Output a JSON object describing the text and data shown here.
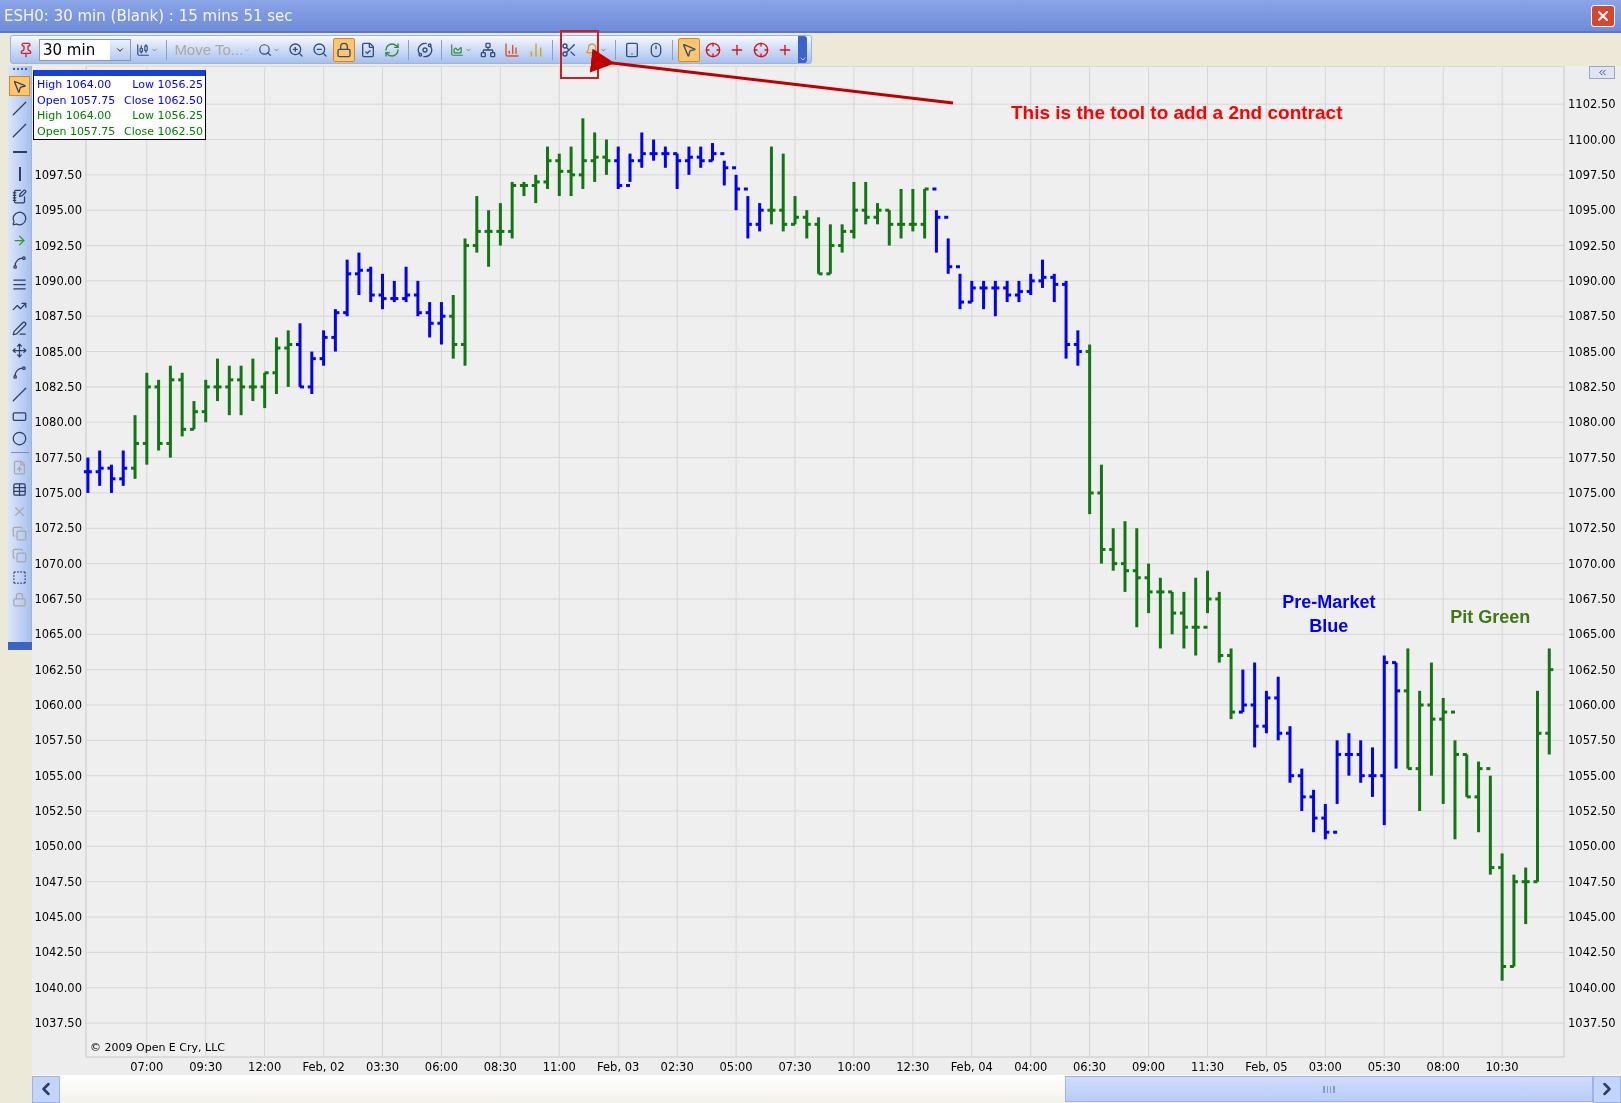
{
  "window": {
    "title": "ESH0: 30 min (Blank) : 15 mins 51 sec"
  },
  "toolbar": {
    "interval": "30 min",
    "move_to": {
      "label": "Move To...",
      "disabled": true
    },
    "buttons": [
      {
        "selected": false
      },
      {
        "selected": false
      },
      {
        "selected": false
      },
      {
        "selected": false
      },
      {
        "selected": false
      },
      {
        "selected": true
      },
      {
        "selected": false
      },
      {
        "selected": false
      },
      {
        "selected": false
      },
      {
        "selected": false
      },
      {
        "selected": false
      },
      {
        "selected": false
      },
      {
        "selected": false
      },
      {
        "selected": false
      },
      {
        "selected": false
      },
      {
        "selected": false
      },
      {
        "selected": false
      },
      {
        "selected": true
      },
      {
        "selected": false
      },
      {
        "selected": false
      },
      {
        "selected": false
      },
      {
        "selected": false
      }
    ]
  },
  "drawing_tools": [
    {
      "selected": true,
      "disabled": false
    },
    {
      "selected": false,
      "disabled": false
    },
    {
      "selected": false,
      "disabled": false
    },
    {
      "selected": false,
      "disabled": false
    },
    {
      "selected": false,
      "disabled": false
    },
    {
      "selected": false,
      "disabled": false
    },
    {
      "selected": false,
      "disabled": false
    },
    {
      "selected": false,
      "disabled": false
    },
    {
      "selected": false,
      "disabled": false
    },
    {
      "selected": false,
      "disabled": false
    },
    {
      "selected": false,
      "disabled": false
    },
    {
      "selected": false,
      "disabled": false
    },
    {
      "selected": false,
      "disabled": false
    },
    {
      "selected": false,
      "disabled": false
    },
    {
      "selected": false,
      "disabled": false
    },
    {
      "selected": false,
      "disabled": false
    },
    {
      "selected": false,
      "disabled": false
    },
    {
      "selected": false,
      "disabled": true
    },
    {
      "selected": false,
      "disabled": false
    },
    {
      "selected": false,
      "disabled": true
    },
    {
      "selected": false,
      "disabled": true
    },
    {
      "selected": false,
      "disabled": true
    },
    {
      "selected": false,
      "disabled": false
    },
    {
      "selected": false,
      "disabled": true
    }
  ],
  "info_box": {
    "lines": [
      {
        "color": "#0000ff",
        "left": "High 1064.00",
        "right": "Low 1056.25"
      },
      {
        "color": "#0000ff",
        "left": "Open 1057.75",
        "right": "Close 1062.50"
      },
      {
        "color": "#008000",
        "left": "High 1064.00",
        "right": "Low 1056.25"
      },
      {
        "color": "#008000",
        "left": "Open 1057.75",
        "right": "Close 1062.50"
      }
    ]
  },
  "callout": {
    "text": "This is the tool to add a 2nd contract"
  },
  "chart": {
    "copyright": "© 2009 Open E Cry, LLC",
    "right_axis": [
      "1102.50",
      "1100.00",
      "1097.50",
      "1095.00",
      "1092.50",
      "1090.00",
      "1087.50",
      "1085.00",
      "1082.50",
      "1080.00",
      "1077.50",
      "1075.00",
      "1072.50",
      "1070.00",
      "1067.50",
      "1065.00",
      "1062.50",
      "1060.00",
      "1057.50",
      "1055.00",
      "1052.50",
      "1050.00",
      "1047.50",
      "1045.00",
      "1042.50",
      "1040.00",
      "1037.50"
    ],
    "left_axis": [
      "1097.50",
      "1095.00",
      "1092.50",
      "1090.00",
      "1087.50",
      "1085.00",
      "1082.50",
      "1080.00",
      "1077.50",
      "1075.00",
      "1072.50",
      "1070.00",
      "1067.50",
      "1065.00",
      "1062.50",
      "1060.00",
      "1057.50",
      "1055.00",
      "1052.50",
      "1050.00",
      "1047.50",
      "1045.00",
      "1042.50",
      "1040.00",
      "1037.50"
    ],
    "time_axis": [
      "07:00",
      "09:30",
      "12:00",
      "Feb, 02",
      "03:30",
      "06:00",
      "08:30",
      "11:00",
      "Feb, 03",
      "02:30",
      "05:00",
      "07:30",
      "10:00",
      "12:30",
      "Feb, 04",
      "04:00",
      "06:30",
      "09:00",
      "11:30",
      "Feb, 05",
      "03:00",
      "05:30",
      "08:00",
      "10:30"
    ],
    "annotations": [
      {
        "text": "Pre-Market\nBlue",
        "color": "#0000ff"
      },
      {
        "text": "Pit Green",
        "color": "#3d7a12"
      }
    ]
  }
}
